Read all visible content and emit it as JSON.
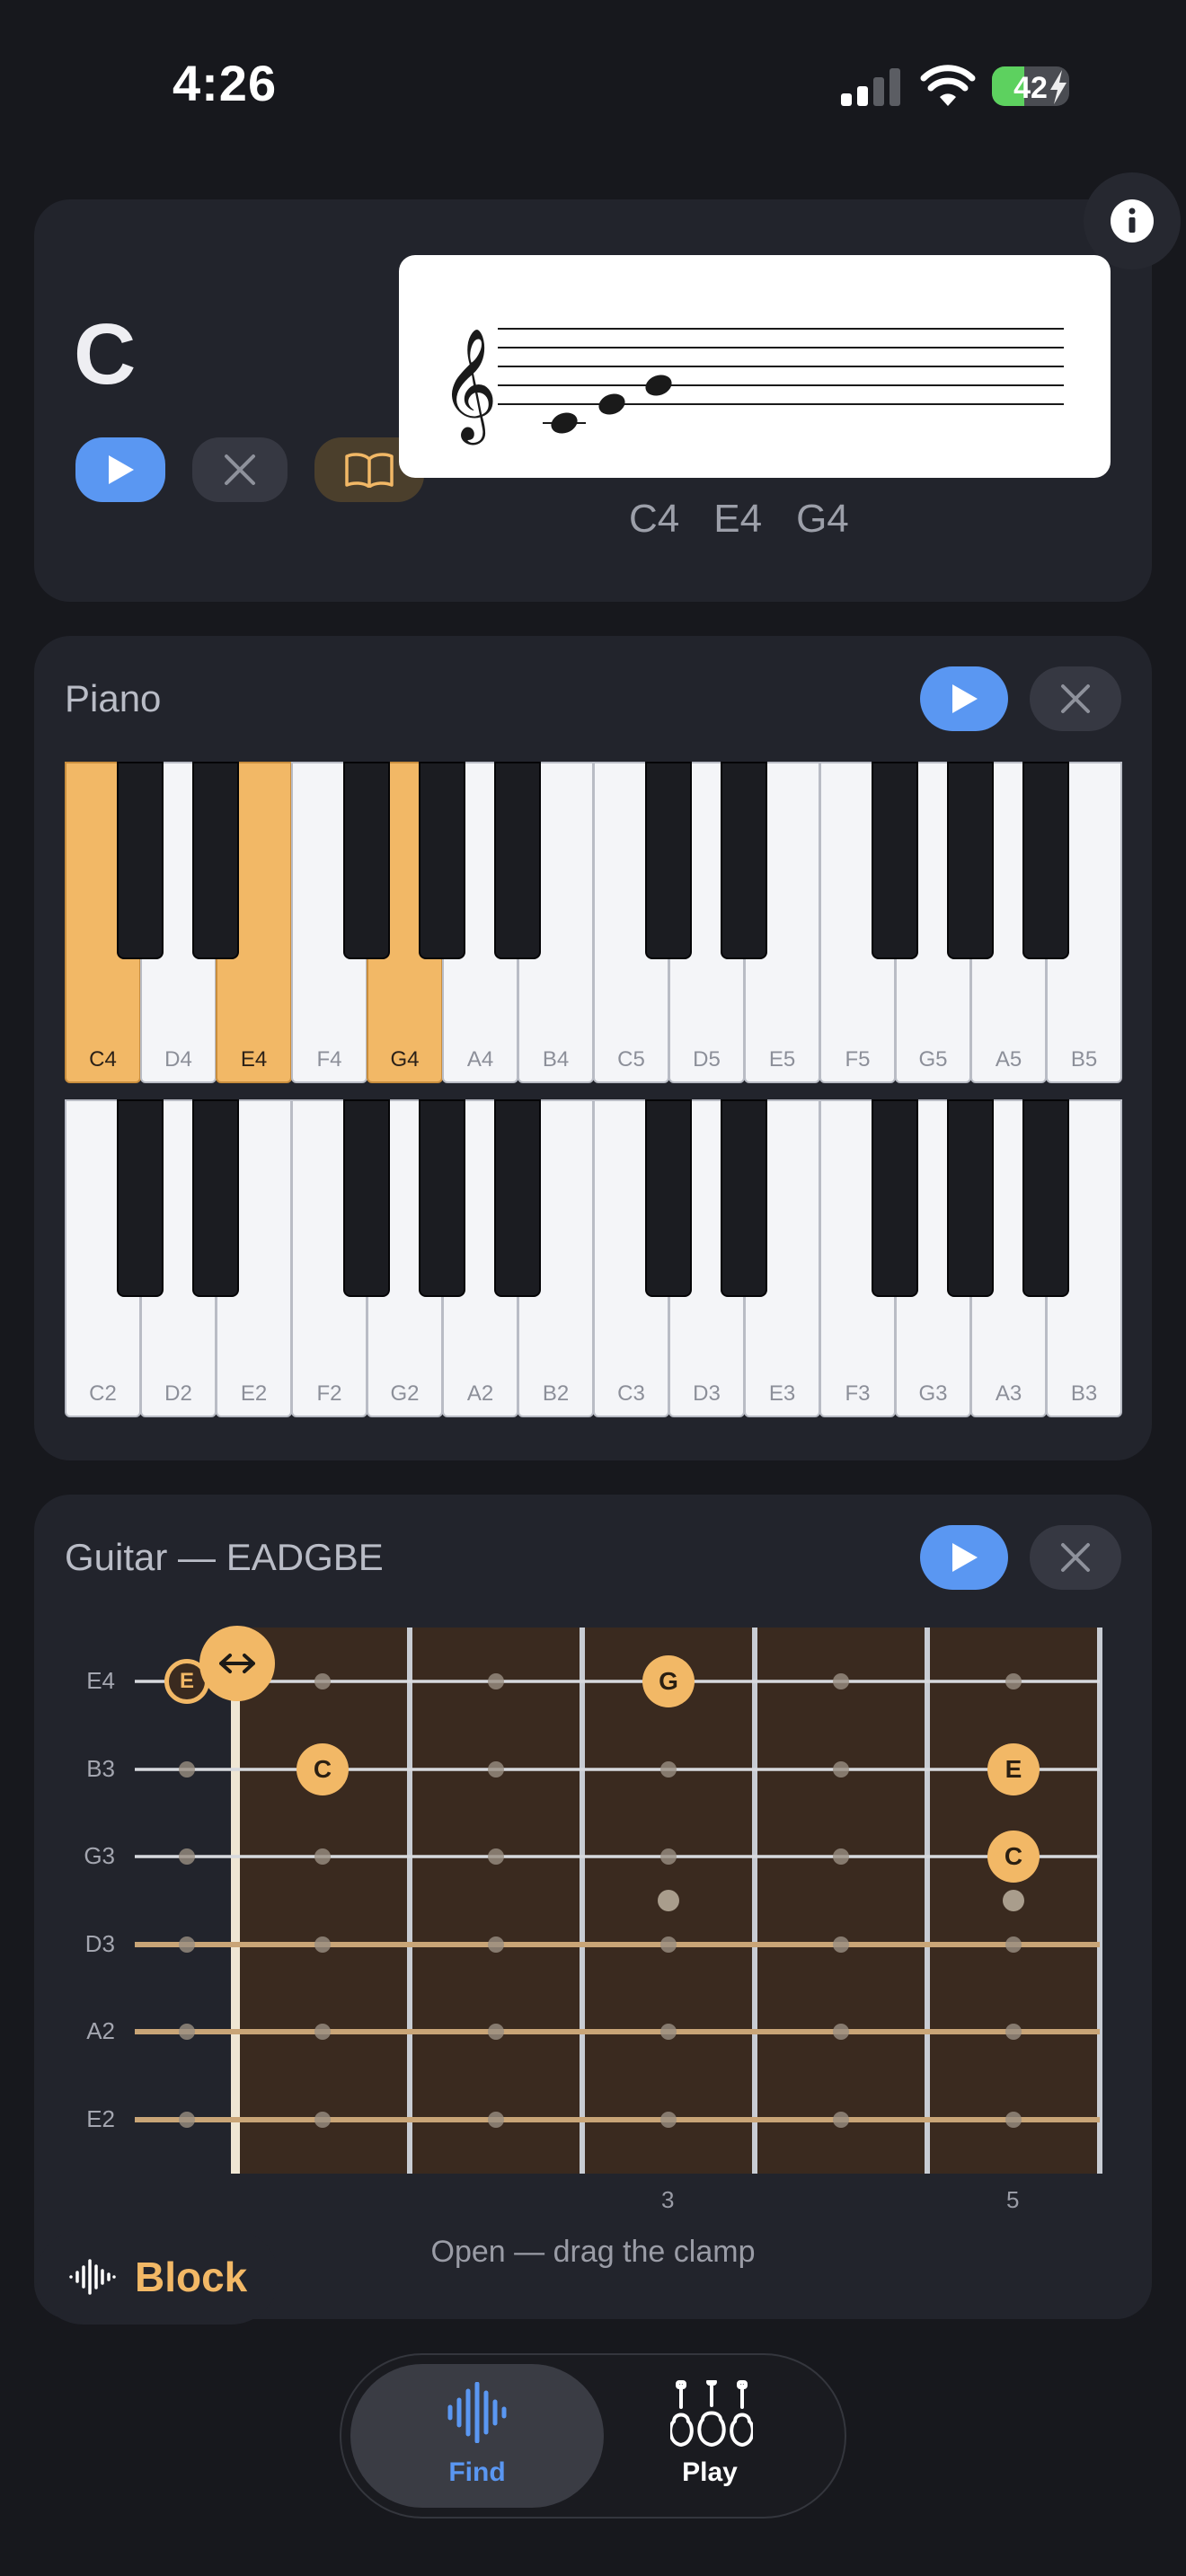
{
  "status_bar": {
    "time": "4:26",
    "battery": "42",
    "battery_level": 0.42
  },
  "chord": {
    "name": "C",
    "notes": [
      "C4",
      "E4",
      "G4"
    ]
  },
  "piano": {
    "title": "Piano",
    "upper_keys": [
      "C4",
      "D4",
      "E4",
      "F4",
      "G4",
      "A4",
      "B4",
      "C5",
      "D5",
      "E5",
      "F5",
      "G5",
      "A5",
      "B5"
    ],
    "lower_keys": [
      "C2",
      "D2",
      "E2",
      "F2",
      "G2",
      "A2",
      "B2",
      "C3",
      "D3",
      "E3",
      "F3",
      "G3",
      "A3",
      "B3"
    ],
    "highlighted": [
      "C4",
      "E4",
      "G4"
    ]
  },
  "guitar": {
    "title": "Guitar — EADGBE",
    "strings": [
      "E4",
      "B3",
      "G3",
      "D3",
      "A2",
      "E2"
    ],
    "fret_numbers": [
      "3",
      "5"
    ],
    "note_markers": [
      {
        "string": "E4",
        "fret": 0,
        "note": "E"
      },
      {
        "string": "E4",
        "fret": 3,
        "note": "G"
      },
      {
        "string": "B3",
        "fret": 1,
        "note": "C"
      },
      {
        "string": "B3",
        "fret": 5,
        "note": "E"
      },
      {
        "string": "G3",
        "fret": 5,
        "note": "C"
      }
    ],
    "clamp_hint": "Open — drag the clamp"
  },
  "block": {
    "label": "Block"
  },
  "tabs": [
    {
      "label": "Find",
      "icon": "waveform-icon",
      "active": true
    },
    {
      "label": "Play",
      "icon": "instruments-icon",
      "active": false
    }
  ],
  "colors": {
    "accent": "#f2b866",
    "primary": "#5a97f2",
    "background": "#17181d",
    "card": "#22242c"
  }
}
